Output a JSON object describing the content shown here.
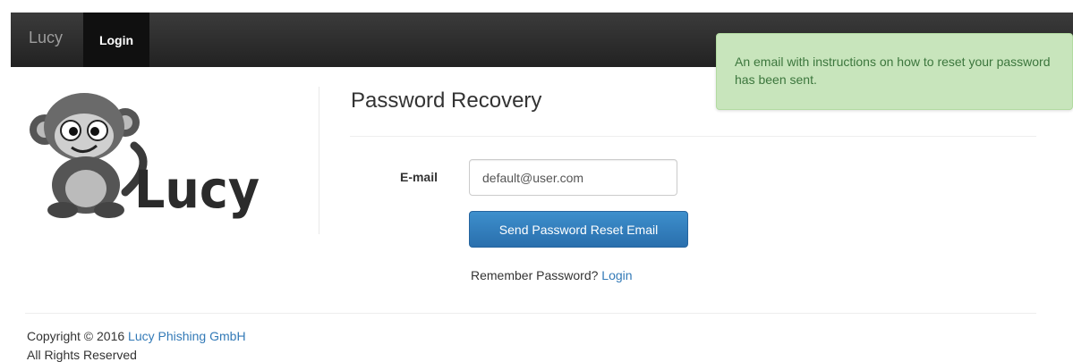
{
  "navbar": {
    "brand": "Lucy",
    "login_label": "Login"
  },
  "alert": {
    "message": "An email with instructions on how to reset your password has been sent."
  },
  "logo": {
    "text": "Lucy"
  },
  "form": {
    "title": "Password Recovery",
    "email_label": "E-mail",
    "email_value": "default@user.com",
    "submit_label": "Send Password Reset Email",
    "remember_text": "Remember Password?",
    "login_link": "Login"
  },
  "footer": {
    "copyright_text": "Copyright © 2016",
    "company_link": "Lucy Phishing GmbH",
    "rights": "All Rights Reserved"
  },
  "colors": {
    "navbar": "#222222",
    "alert_bg": "#c8e5bc",
    "alert_text": "#3c763d",
    "primary_button": "#337ab7",
    "link": "#337ab7"
  }
}
